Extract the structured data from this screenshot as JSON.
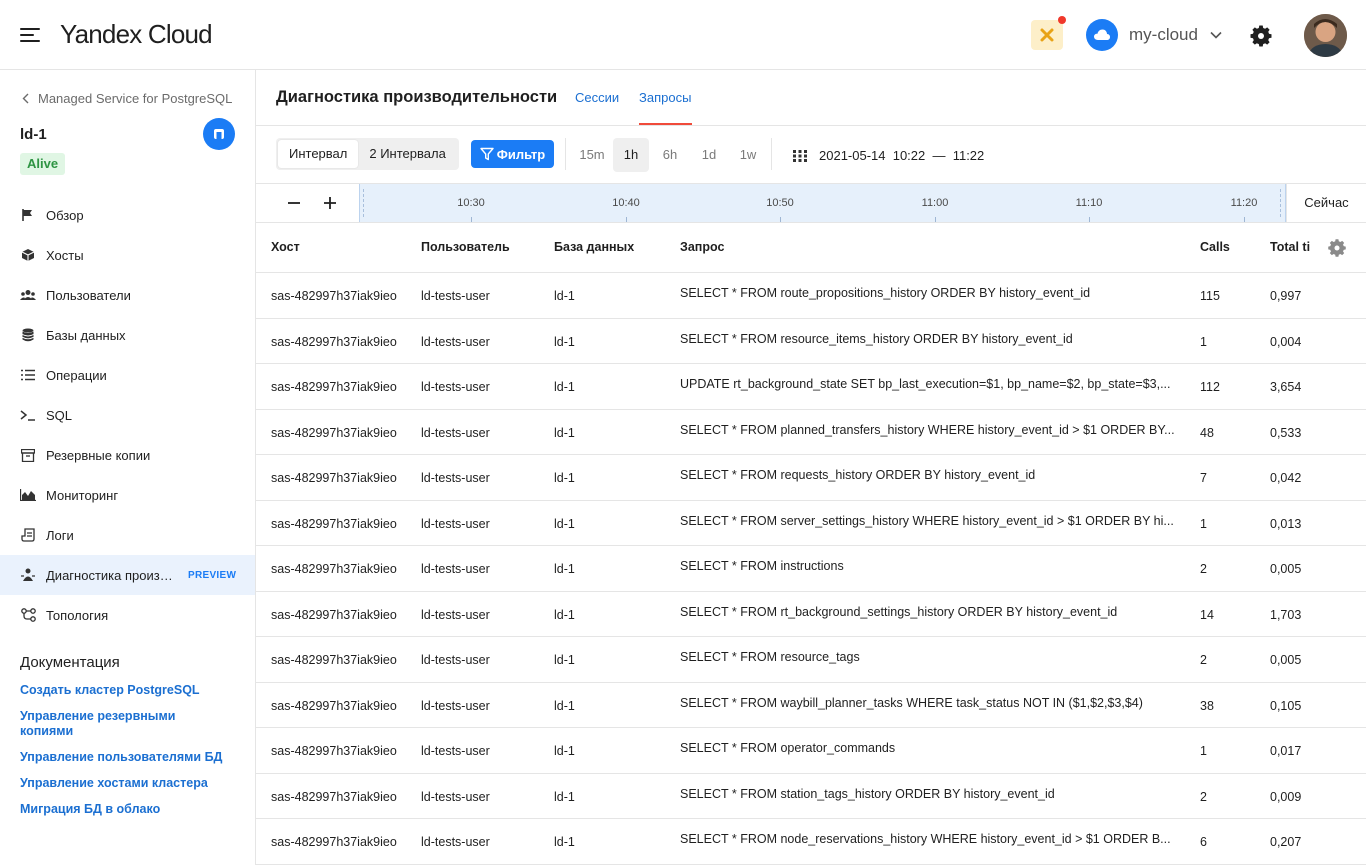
{
  "header": {
    "logo_brand": "Yandex",
    "logo_product": "Cloud",
    "cloud_name": "my-cloud",
    "accent_color": "#1b7cf5"
  },
  "sidebar": {
    "back_label": "Managed Service for PostgreSQL",
    "cluster_name": "ld-1",
    "status": "Alive",
    "items": [
      {
        "label": "Обзор",
        "icon": "flag-icon"
      },
      {
        "label": "Хосты",
        "icon": "cube-icon"
      },
      {
        "label": "Пользователи",
        "icon": "users-icon"
      },
      {
        "label": "Базы данных",
        "icon": "database-icon"
      },
      {
        "label": "Операции",
        "icon": "list-icon"
      },
      {
        "label": "SQL",
        "icon": "terminal-icon"
      },
      {
        "label": "Резервные копии",
        "icon": "archive-icon"
      },
      {
        "label": "Мониторинг",
        "icon": "chart-icon"
      },
      {
        "label": "Логи",
        "icon": "logs-icon"
      },
      {
        "label": "Диагностика произ…",
        "icon": "diagnostics-icon",
        "badge": "PREVIEW",
        "active": true
      },
      {
        "label": "Топология",
        "icon": "topology-icon"
      }
    ],
    "docs_title": "Документация",
    "docs": [
      "Создать кластер PostgreSQL",
      "Управление резервными копиями",
      "Управление пользователями БД",
      "Управление хостами кластера",
      "Миграция БД в облако"
    ]
  },
  "main": {
    "title": "Диагностика производительности",
    "tabs": [
      "Сессии",
      "Запросы"
    ],
    "active_tab": "Запросы",
    "toolbar": {
      "interval": "Интервал",
      "two_intervals": "2 Интервала",
      "filter": "Фильтр",
      "ranges": [
        "15m",
        "1h",
        "6h",
        "1d",
        "1w"
      ],
      "selected_range": "1h",
      "date_range": "2021-05-14  10:22  —  11:22"
    },
    "timeline": {
      "ticks": [
        "10:30",
        "10:40",
        "10:50",
        "11:00",
        "11:10",
        "11:20"
      ],
      "now": "Сейчас"
    },
    "table": {
      "columns": [
        "Хост",
        "Пользователь",
        "База данных",
        "Запрос",
        "Calls",
        "Total ti"
      ],
      "rows": [
        {
          "host": "sas-482997h37iak9ieo",
          "user": "ld-tests-user",
          "db": "ld-1",
          "query": "SELECT * FROM route_propositions_history ORDER BY history_event_id",
          "calls": "115",
          "total": "0,997"
        },
        {
          "host": "sas-482997h37iak9ieo",
          "user": "ld-tests-user",
          "db": "ld-1",
          "query": "SELECT * FROM resource_items_history ORDER BY history_event_id",
          "calls": "1",
          "total": "0,004"
        },
        {
          "host": "sas-482997h37iak9ieo",
          "user": "ld-tests-user",
          "db": "ld-1",
          "query": "UPDATE rt_background_state SET bp_last_execution=$1, bp_name=$2, bp_state=$3,...",
          "calls": "112",
          "total": "3,654"
        },
        {
          "host": "sas-482997h37iak9ieo",
          "user": "ld-tests-user",
          "db": "ld-1",
          "query": "SELECT * FROM planned_transfers_history WHERE history_event_id > $1 ORDER BY...",
          "calls": "48",
          "total": "0,533"
        },
        {
          "host": "sas-482997h37iak9ieo",
          "user": "ld-tests-user",
          "db": "ld-1",
          "query": "SELECT * FROM requests_history ORDER BY history_event_id",
          "calls": "7",
          "total": "0,042"
        },
        {
          "host": "sas-482997h37iak9ieo",
          "user": "ld-tests-user",
          "db": "ld-1",
          "query": "SELECT * FROM server_settings_history WHERE history_event_id > $1 ORDER BY hi...",
          "calls": "1",
          "total": "0,013"
        },
        {
          "host": "sas-482997h37iak9ieo",
          "user": "ld-tests-user",
          "db": "ld-1",
          "query": "SELECT * FROM instructions",
          "calls": "2",
          "total": "0,005"
        },
        {
          "host": "sas-482997h37iak9ieo",
          "user": "ld-tests-user",
          "db": "ld-1",
          "query": "SELECT * FROM rt_background_settings_history ORDER BY history_event_id",
          "calls": "14",
          "total": "1,703"
        },
        {
          "host": "sas-482997h37iak9ieo",
          "user": "ld-tests-user",
          "db": "ld-1",
          "query": "SELECT * FROM resource_tags",
          "calls": "2",
          "total": "0,005"
        },
        {
          "host": "sas-482997h37iak9ieo",
          "user": "ld-tests-user",
          "db": "ld-1",
          "query": "SELECT * FROM waybill_planner_tasks WHERE task_status NOT IN ($1,$2,$3,$4)",
          "calls": "38",
          "total": "0,105"
        },
        {
          "host": "sas-482997h37iak9ieo",
          "user": "ld-tests-user",
          "db": "ld-1",
          "query": "SELECT * FROM operator_commands",
          "calls": "1",
          "total": "0,017"
        },
        {
          "host": "sas-482997h37iak9ieo",
          "user": "ld-tests-user",
          "db": "ld-1",
          "query": "SELECT * FROM station_tags_history ORDER BY history_event_id",
          "calls": "2",
          "total": "0,009"
        },
        {
          "host": "sas-482997h37iak9ieo",
          "user": "ld-tests-user",
          "db": "ld-1",
          "query": "SELECT * FROM node_reservations_history WHERE history_event_id > $1 ORDER B...",
          "calls": "6",
          "total": "0,207"
        }
      ]
    }
  }
}
